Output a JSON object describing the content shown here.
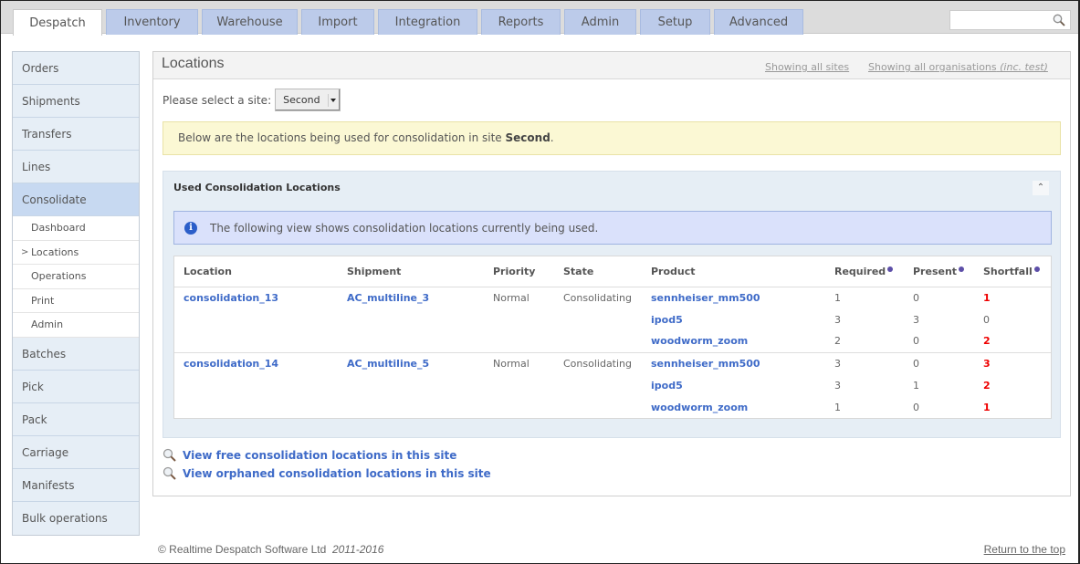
{
  "nav": {
    "tabs": [
      {
        "label": "Despatch",
        "active": true
      },
      {
        "label": "Inventory"
      },
      {
        "label": "Warehouse"
      },
      {
        "label": "Import"
      },
      {
        "label": "Integration"
      },
      {
        "label": "Reports"
      },
      {
        "label": "Admin"
      },
      {
        "label": "Setup"
      },
      {
        "label": "Advanced"
      }
    ],
    "search": {
      "value": "",
      "icon": "search-icon"
    }
  },
  "sidebar": {
    "items_top": [
      "Orders",
      "Shipments",
      "Transfers",
      "Lines"
    ],
    "active": "Consolidate",
    "sub_items": [
      "Dashboard",
      "Locations",
      "Operations",
      "Print",
      "Admin"
    ],
    "current_sub": "Locations",
    "current_marker": ">",
    "items_bottom": [
      "Batches",
      "Pick",
      "Pack",
      "Carriage",
      "Manifests",
      "Bulk operations"
    ]
  },
  "page": {
    "title": "Locations",
    "header_links": {
      "sites": "Showing all sites",
      "orgs": "Showing all organisations",
      "orgs_suffix": "(inc. test)"
    },
    "site_select": {
      "label": "Please select a site:",
      "value": "Second"
    },
    "notice": {
      "prefix": "Below are the locations being used for consolidation in site ",
      "site": "Second",
      "suffix": "."
    }
  },
  "panel": {
    "title": "Used Consolidation Locations",
    "collapse_icon": "chevron-double-up-icon",
    "info": "The following view shows consolidation locations currently being used.",
    "columns": [
      "Location",
      "Shipment",
      "Priority",
      "State",
      "Product",
      "Required",
      "Present",
      "Shortfall"
    ],
    "groups": [
      {
        "location": "consolidation_13",
        "shipment": "AC_multiline_3",
        "priority": "Normal",
        "state": "Consolidating",
        "lines": [
          {
            "product": "sennheiser_mm500",
            "required": "1",
            "present": "0",
            "shortfall": "1"
          },
          {
            "product": "ipod5",
            "required": "3",
            "present": "3",
            "shortfall": "0"
          },
          {
            "product": "woodworm_zoom",
            "required": "2",
            "present": "0",
            "shortfall": "2"
          }
        ]
      },
      {
        "location": "consolidation_14",
        "shipment": "AC_multiline_5",
        "priority": "Normal",
        "state": "Consolidating",
        "lines": [
          {
            "product": "sennheiser_mm500",
            "required": "3",
            "present": "0",
            "shortfall": "3"
          },
          {
            "product": "ipod5",
            "required": "3",
            "present": "1",
            "shortfall": "2"
          },
          {
            "product": "woodworm_zoom",
            "required": "1",
            "present": "0",
            "shortfall": "1"
          }
        ]
      }
    ]
  },
  "links": {
    "free": "View free consolidation locations in this site",
    "orphaned": "View orphaned consolidation locations in this site"
  },
  "footer": {
    "copyright": "© Realtime Despatch Software Ltd",
    "years": "2011-2016",
    "top_link": "Return to the top"
  },
  "colors": {
    "accent_link": "#3f6bc8",
    "shortfall_red": "#ee0000",
    "tab_bg": "#bccbea",
    "notice_bg": "#fbf8d4",
    "info_bg": "#dae1fb"
  }
}
